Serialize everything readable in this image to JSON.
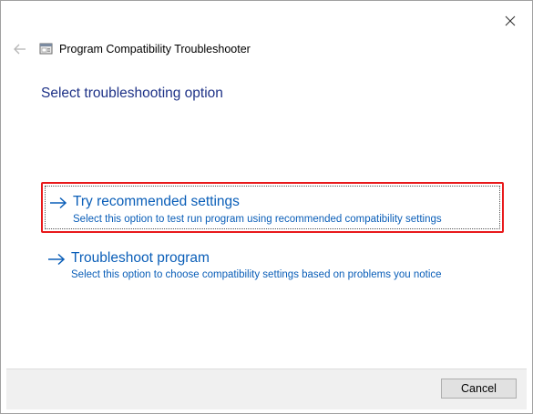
{
  "window": {
    "title": "Program Compatibility Troubleshooter"
  },
  "icons": {
    "close": "close-icon",
    "back": "back-arrow-icon",
    "app": "troubleshooter-app-icon",
    "option_arrow": "right-arrow-icon"
  },
  "main": {
    "heading": "Select troubleshooting option",
    "options": [
      {
        "title": "Try recommended settings",
        "description": "Select this option to test run program using recommended compatibility settings",
        "highlighted": true
      },
      {
        "title": "Troubleshoot program",
        "description": "Select this option to choose compatibility settings based on problems you notice",
        "highlighted": false
      }
    ]
  },
  "footer": {
    "cancel_label": "Cancel"
  },
  "colors": {
    "heading": "#1e3287",
    "link": "#0a5eb8",
    "highlight_border": "#e8191b",
    "footer_bg": "#f0f0f0"
  }
}
